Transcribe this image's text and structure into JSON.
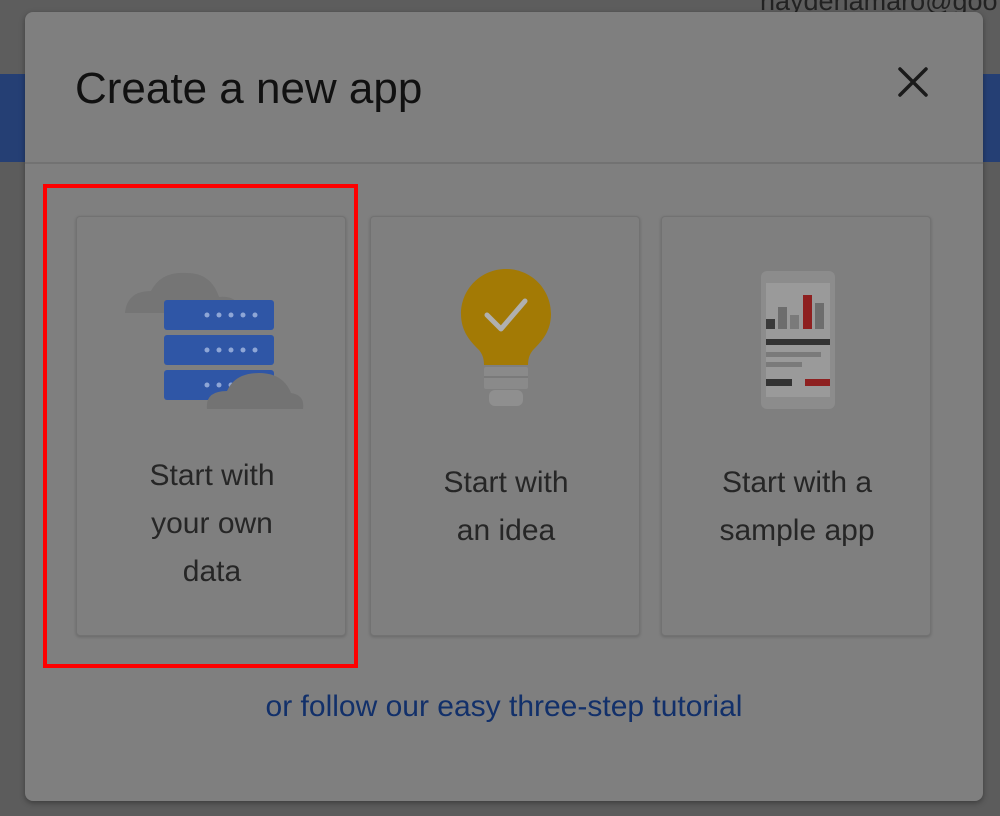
{
  "background": {
    "user_email": "haydenamaro@goo"
  },
  "dialog": {
    "title": "Create a new app",
    "close_icon": "close-icon",
    "cards": [
      {
        "line1": "Start with",
        "line2": "your own",
        "line3": "data",
        "icon": "server-database-icon"
      },
      {
        "line1": "Start with",
        "line2": "an idea",
        "icon": "lightbulb-check-icon"
      },
      {
        "line1": "Start with a",
        "line2": "sample app",
        "icon": "phone-chart-icon"
      }
    ],
    "tutorial_link": "or follow our easy three-step tutorial"
  },
  "colors": {
    "highlight": "#ff0000",
    "link": "#12306a",
    "server_blue": "#2f56a6",
    "bulb_gold": "#a37a05"
  }
}
